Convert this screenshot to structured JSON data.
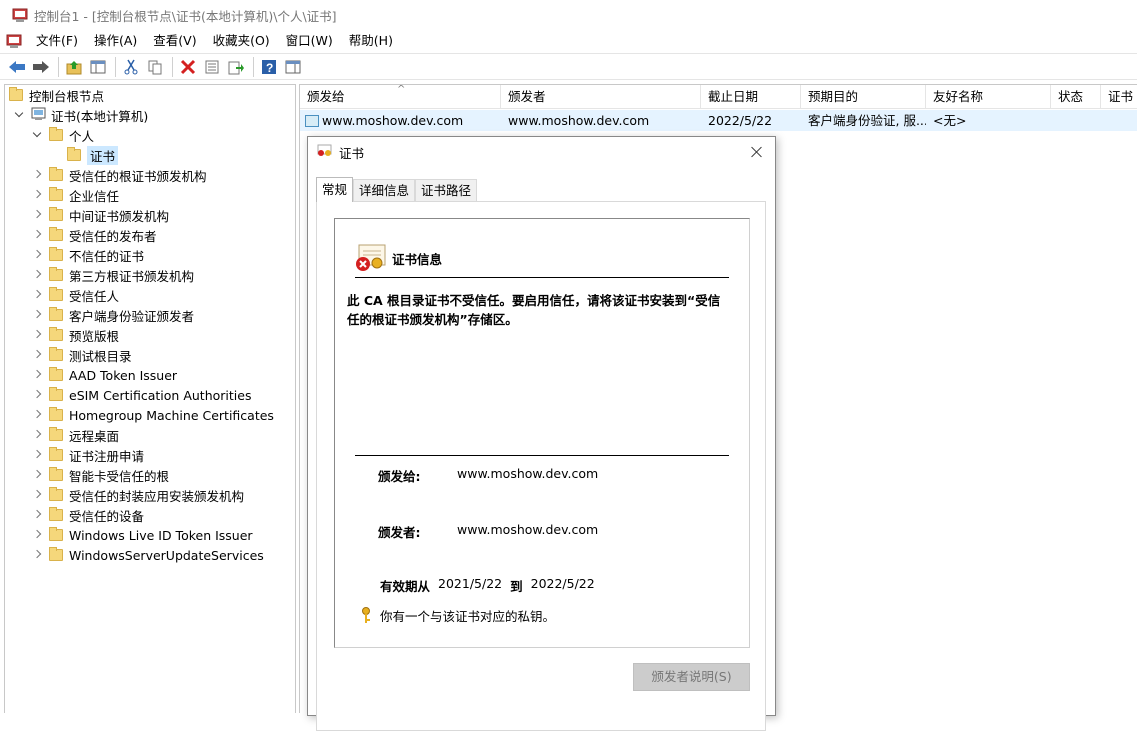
{
  "window": {
    "title": "控制台1 - [控制台根节点\\证书(本地计算机)\\个人\\证书]"
  },
  "menu": [
    "文件(F)",
    "操作(A)",
    "查看(V)",
    "收藏夹(O)",
    "窗口(W)",
    "帮助(H)"
  ],
  "toolbar": [
    "back-icon",
    "forward-icon",
    "up-folder-icon",
    "show-hide-tree-icon",
    "cut-icon",
    "copy-icon",
    "delete-icon",
    "properties-icon",
    "export-icon",
    "help-icon",
    "action-pane-icon"
  ],
  "tree": {
    "root": "控制台根节点",
    "computer": "证书(本地计算机)",
    "personal": "个人",
    "selected": "证书",
    "stores": [
      "受信任的根证书颁发机构",
      "企业信任",
      "中间证书颁发机构",
      "受信任的发布者",
      "不信任的证书",
      "第三方根证书颁发机构",
      "受信任人",
      "客户端身份验证颁发者",
      "预览版根",
      "测试根目录",
      "AAD Token Issuer",
      "eSIM Certification Authorities",
      "Homegroup Machine Certificates",
      "远程桌面",
      "证书注册申请",
      "智能卡受信任的根",
      "受信任的封装应用安装颁发机构",
      "受信任的设备",
      "Windows Live ID Token Issuer",
      "WindowsServerUpdateServices"
    ]
  },
  "list": {
    "columns": [
      "颁发给",
      "颁发者",
      "截止日期",
      "预期目的",
      "友好名称",
      "状态",
      "证书"
    ],
    "rows": [
      {
        "issued_to": "www.moshow.dev.com",
        "issued_by": "www.moshow.dev.com",
        "expires": "2022/5/22",
        "purpose": "客户端身份验证, 服...",
        "friendly": "<无>"
      }
    ]
  },
  "dialog": {
    "title": "证书",
    "tabs": [
      "常规",
      "详细信息",
      "证书路径"
    ],
    "info_title": "证书信息",
    "warning": "此 CA 根目录证书不受信任。要启用信任，请将该证书安装到“受信任的根证书颁发机构”存储区。",
    "issued_to_label": "颁发给:",
    "issued_to": "www.moshow.dev.com",
    "issued_by_label": "颁发者:",
    "issued_by": "www.moshow.dev.com",
    "valid_label": "有效期从",
    "valid_from": "2021/5/22",
    "valid_to_label": "到",
    "valid_to": "2022/5/22",
    "key_note": "你有一个与该证书对应的私钥。",
    "issuer_statement": "颁发者说明(S)"
  }
}
